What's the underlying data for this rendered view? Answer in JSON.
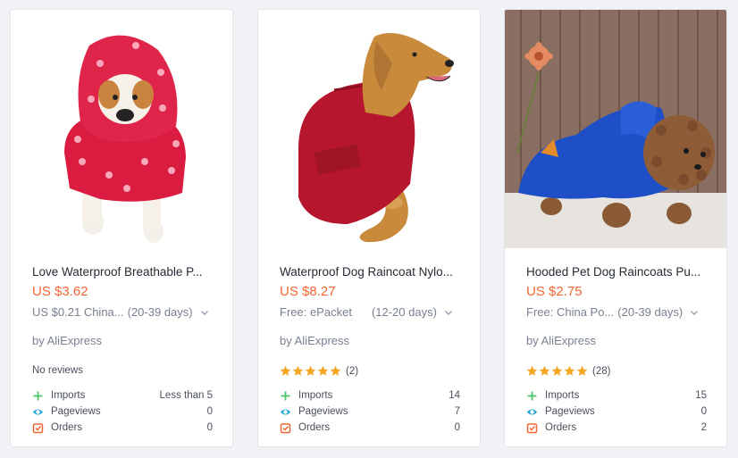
{
  "colors": {
    "price": "#f26633",
    "imports_icon": "#4cc46a",
    "pageviews_icon": "#27a7d8",
    "orders_icon": "#f26633",
    "star": "#f5a623"
  },
  "products": [
    {
      "title": "Love Waterproof Breathable P...",
      "price": "US $3.62",
      "shipping_method": "US $0.21 China...",
      "shipping_days": "(20-39 days)",
      "seller": "by AliExpress",
      "reviews_text": "No reviews",
      "rating_stars": 0,
      "review_count": "",
      "imports_label": "Imports",
      "imports": "Less than 5",
      "pageviews_label": "Pageviews",
      "pageviews": "0",
      "orders_label": "Orders",
      "orders": "0"
    },
    {
      "title": "Waterproof Dog Raincoat Nylo...",
      "price": "US $8.27",
      "shipping_method": "Free: ePacket",
      "shipping_days": "(12-20 days)",
      "seller": "by AliExpress",
      "reviews_text": "",
      "rating_stars": 5,
      "review_count": "(2)",
      "imports_label": "Imports",
      "imports": "14",
      "pageviews_label": "Pageviews",
      "pageviews": "7",
      "orders_label": "Orders",
      "orders": "0"
    },
    {
      "title": "Hooded Pet Dog Raincoats Pu...",
      "price": "US $2.75",
      "shipping_method": "Free: China Po...",
      "shipping_days": "(20-39 days)",
      "seller": "by AliExpress",
      "reviews_text": "",
      "rating_stars": 5,
      "review_count": "(28)",
      "imports_label": "Imports",
      "imports": "15",
      "pageviews_label": "Pageviews",
      "pageviews": "0",
      "orders_label": "Orders",
      "orders": "2"
    }
  ]
}
